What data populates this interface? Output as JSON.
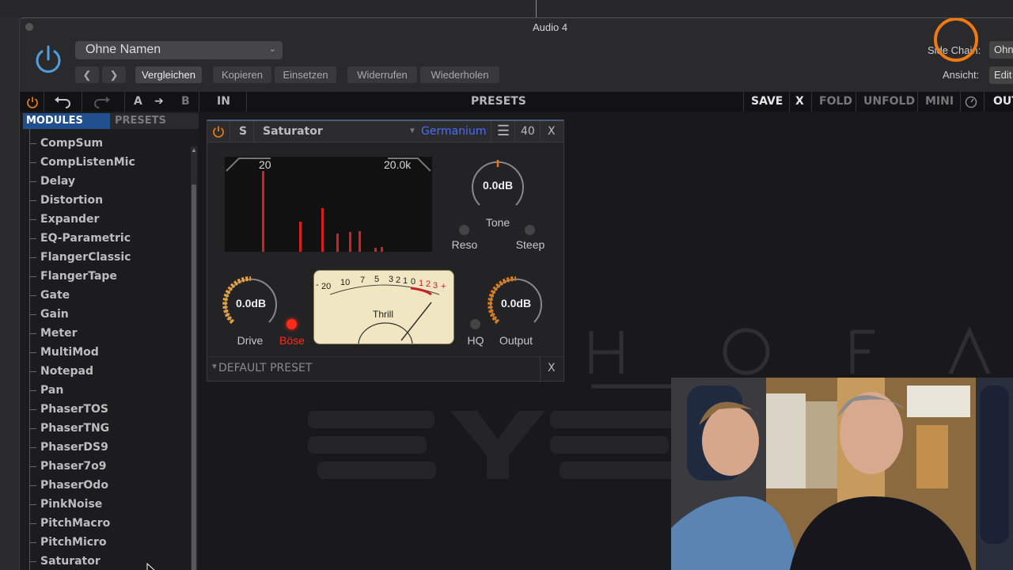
{
  "window": {
    "title": "Audio 4"
  },
  "header": {
    "preset_name": "Ohne Namen",
    "buttons": [
      {
        "label": "Vergleichen",
        "active": true
      },
      {
        "label": "Kopieren",
        "active": false
      },
      {
        "label": "Einsetzen",
        "active": false
      },
      {
        "label": "Widerrufen",
        "active": false
      },
      {
        "label": "Wiederholen",
        "active": false
      }
    ],
    "side_chain_label": "Side Chain:",
    "side_chain_value": "Ohne",
    "view_label": "Ansicht:",
    "view_value": "Edit"
  },
  "toolbar": {
    "a": "A",
    "b": "B",
    "in": "IN",
    "presets": "PRESETS",
    "save": "SAVE",
    "close": "X",
    "fold": "FOLD",
    "unfold": "UNFOLD",
    "mini": "MINI",
    "out": "OUT"
  },
  "sidebar": {
    "tab_modules": "MODULES",
    "tab_presets": "PRESETS",
    "items": [
      "CompSum",
      "CompListenMic",
      "Delay",
      "Distortion",
      "Expander",
      "EQ-Parametric",
      "FlangerClassic",
      "FlangerTape",
      "Gate",
      "Gain",
      "Meter",
      "MultiMod",
      "Notepad",
      "Pan",
      "PhaserTOS",
      "PhaserTNG",
      "PhaserDS9",
      "Phaser7o9",
      "PhaserOdo",
      "PinkNoise",
      "PitchMacro",
      "PitchMicro",
      "Saturator"
    ]
  },
  "module": {
    "solo": "S",
    "name": "Saturator",
    "mode": "Germanium",
    "count": "40",
    "close": "X",
    "spec_low": "20",
    "spec_high": "20.0k",
    "spectrum_levels": [
      0.85,
      0.32,
      0.46,
      0.19,
      0.21,
      0.22,
      0.04,
      0.05
    ],
    "tone": {
      "value": "0.0dB",
      "label": "Tone"
    },
    "reso_label": "Reso",
    "steep_label": "Steep",
    "drive": {
      "value": "0.0dB",
      "label": "Drive"
    },
    "boese_label": "Böse",
    "vu": {
      "label": "Thrill",
      "scale": [
        "20",
        "10",
        "7",
        "5",
        "3",
        "2",
        "1",
        "0"
      ],
      "red_scale": [
        "1",
        "2",
        "3"
      ],
      "minus": "-",
      "plus": "+"
    },
    "hq_label": "HQ",
    "output": {
      "value": "0.0dB",
      "label": "Output"
    },
    "default_preset": "DEFAULT PRESET",
    "preset_close": "X"
  },
  "colors": {
    "accent_orange": "#e07a12",
    "module_blue": "#4a6cff",
    "tab_blue": "#1f4f8c",
    "led_red": "#ff2a1a",
    "spectrum_red": "#d3221e"
  }
}
